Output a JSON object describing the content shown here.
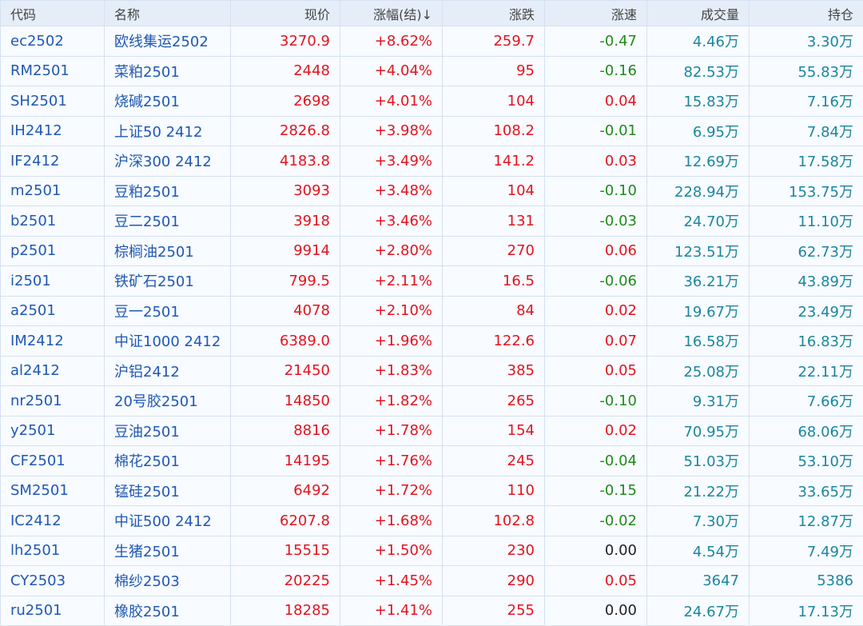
{
  "headers": [
    "代码",
    "名称",
    "现价",
    "涨幅(结)↓",
    "涨跌",
    "涨速",
    "成交量",
    "持仓"
  ],
  "colors": {
    "up": "#e3141f",
    "down": "#1f8a1a",
    "flat": "#222222",
    "volume": "#1a86a0",
    "link": "#1f58b4"
  },
  "rows": [
    [
      "ec2502",
      "欧线集运2502",
      "3270.9",
      "+8.62%",
      "259.7",
      "-0.47",
      "4.46万",
      "3.30万"
    ],
    [
      "RM2501",
      "菜粕2501",
      "2448",
      "+4.04%",
      "95",
      "-0.16",
      "82.53万",
      "55.83万"
    ],
    [
      "SH2501",
      "烧碱2501",
      "2698",
      "+4.01%",
      "104",
      "0.04",
      "15.83万",
      "7.16万"
    ],
    [
      "IH2412",
      "上证50 2412",
      "2826.8",
      "+3.98%",
      "108.2",
      "-0.01",
      "6.95万",
      "7.84万"
    ],
    [
      "IF2412",
      "沪深300 2412",
      "4183.8",
      "+3.49%",
      "141.2",
      "0.03",
      "12.69万",
      "17.58万"
    ],
    [
      "m2501",
      "豆粕2501",
      "3093",
      "+3.48%",
      "104",
      "-0.10",
      "228.94万",
      "153.75万"
    ],
    [
      "b2501",
      "豆二2501",
      "3918",
      "+3.46%",
      "131",
      "-0.03",
      "24.70万",
      "11.10万"
    ],
    [
      "p2501",
      "棕榈油2501",
      "9914",
      "+2.80%",
      "270",
      "0.06",
      "123.51万",
      "62.73万"
    ],
    [
      "i2501",
      "铁矿石2501",
      "799.5",
      "+2.11%",
      "16.5",
      "-0.06",
      "36.21万",
      "43.89万"
    ],
    [
      "a2501",
      "豆一2501",
      "4078",
      "+2.10%",
      "84",
      "0.02",
      "19.67万",
      "23.49万"
    ],
    [
      "IM2412",
      "中证1000 2412",
      "6389.0",
      "+1.96%",
      "122.6",
      "0.07",
      "16.58万",
      "16.83万"
    ],
    [
      "al2412",
      "沪铝2412",
      "21450",
      "+1.83%",
      "385",
      "0.05",
      "25.08万",
      "22.11万"
    ],
    [
      "nr2501",
      "20号胶2501",
      "14850",
      "+1.82%",
      "265",
      "-0.10",
      "9.31万",
      "7.66万"
    ],
    [
      "y2501",
      "豆油2501",
      "8816",
      "+1.78%",
      "154",
      "0.02",
      "70.95万",
      "68.06万"
    ],
    [
      "CF2501",
      "棉花2501",
      "14195",
      "+1.76%",
      "245",
      "-0.04",
      "51.03万",
      "53.10万"
    ],
    [
      "SM2501",
      "锰硅2501",
      "6492",
      "+1.72%",
      "110",
      "-0.15",
      "21.22万",
      "33.65万"
    ],
    [
      "IC2412",
      "中证500 2412",
      "6207.8",
      "+1.68%",
      "102.8",
      "-0.02",
      "7.30万",
      "12.87万"
    ],
    [
      "lh2501",
      "生猪2501",
      "15515",
      "+1.50%",
      "230",
      "0.00",
      "4.54万",
      "7.49万"
    ],
    [
      "CY2503",
      "棉纱2503",
      "20225",
      "+1.45%",
      "290",
      "0.05",
      "3647",
      "5386"
    ],
    [
      "ru2501",
      "橡胶2501",
      "18285",
      "+1.41%",
      "255",
      "0.00",
      "24.67万",
      "17.13万"
    ]
  ]
}
